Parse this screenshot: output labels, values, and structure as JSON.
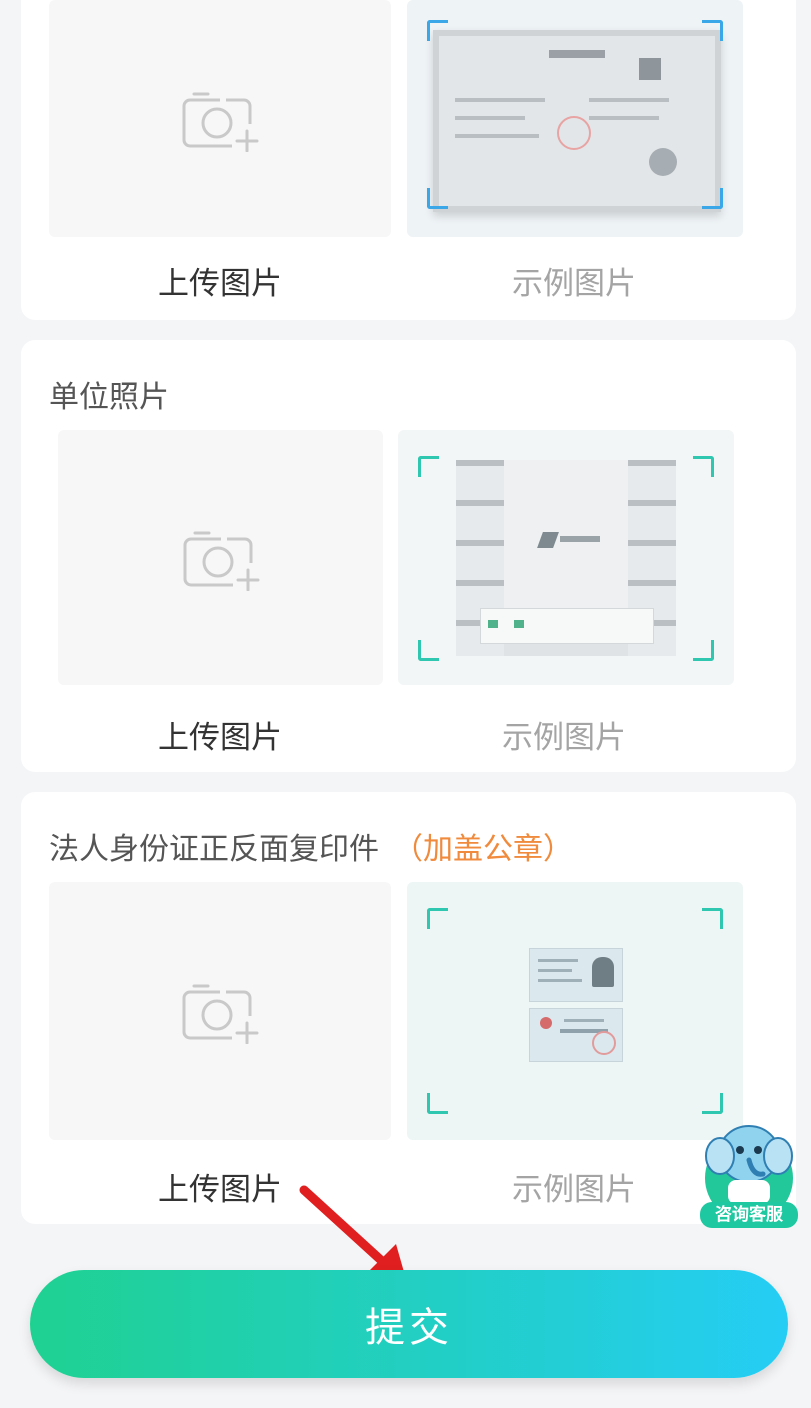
{
  "sections": [
    {
      "title": "",
      "upload_label": "上传图片",
      "example_label": "示例图片",
      "example_kind": "business-license",
      "corner_color": "#3aa8e8"
    },
    {
      "title": "单位照片",
      "upload_label": "上传图片",
      "example_label": "示例图片",
      "example_kind": "office-photo",
      "corner_color": "#2fc7b0"
    },
    {
      "title": "法人身份证正反面复印件",
      "note": "（加盖公章）",
      "upload_label": "上传图片",
      "example_label": "示例图片",
      "example_kind": "id-card-copy",
      "corner_color": "#2fc7b0"
    }
  ],
  "submit_label": "提交",
  "customer_service_label": "咨询客服",
  "colors": {
    "accent_orange": "#f08a3c",
    "button_gradient_start": "#1fd191",
    "button_gradient_end": "#25cdf5"
  }
}
